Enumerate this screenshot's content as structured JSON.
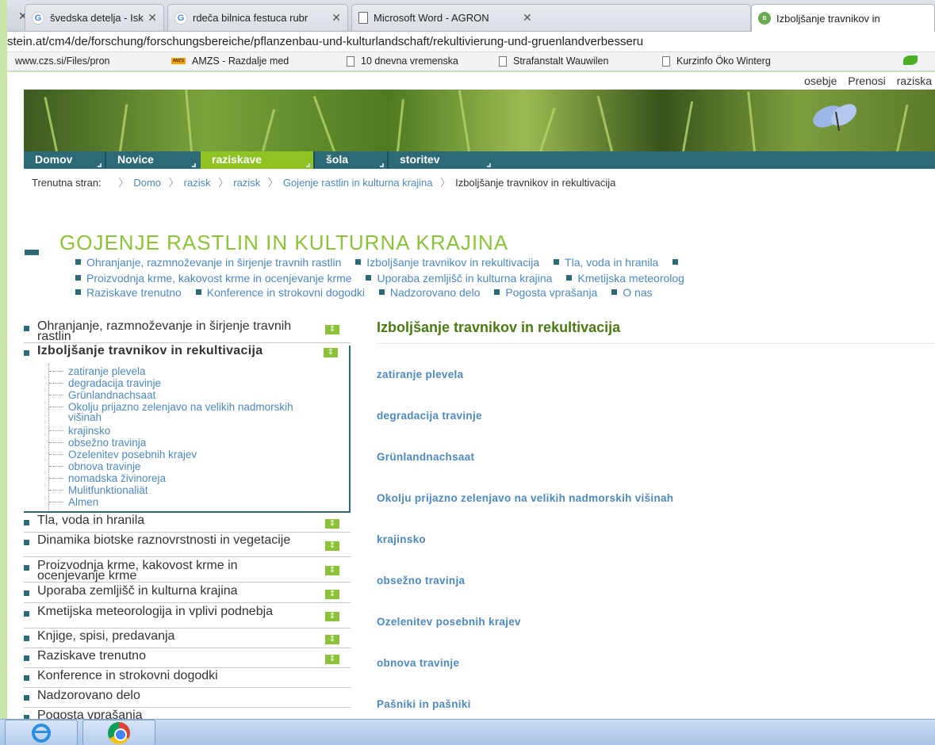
{
  "browser": {
    "tabs": [
      {
        "title": "švedska detelja - Iskanje",
        "icon": "google-icon",
        "active": false
      },
      {
        "title": "rdeča bilnica festuca rubr",
        "icon": "google-icon",
        "active": false
      },
      {
        "title": "Microsoft Word - AGRON",
        "icon": "document-icon",
        "active": false
      },
      {
        "title": "Izboljšanje travnikov in",
        "icon": "site-icon",
        "active": true
      }
    ],
    "url": "stein.at/cm4/de/forschung/forschungsbereiche/pflanzenbau-und-kulturlandschaft/rekultivierung-und-gruenlandverbesseru",
    "bookmarks": [
      {
        "label": "www.czs.si/Files/pron",
        "icon": "none"
      },
      {
        "label": "AMZS - Razdalje med",
        "icon": "amzs-icon"
      },
      {
        "label": "10 dnevna vremenska",
        "icon": "page-icon"
      },
      {
        "label": "Strafanstalt Wauwilen",
        "icon": "page-icon"
      },
      {
        "label": "Kurzinfo Öko Winterg",
        "icon": "page-icon"
      }
    ]
  },
  "site": {
    "topnav": [
      "osebje",
      "Prenosi",
      "raziska"
    ],
    "mainnav": [
      "Domov",
      "Novice",
      "raziskave",
      "šola",
      "storitev"
    ],
    "active_nav": "raziskave",
    "breadcrumb": {
      "prefix": "Trenutna stran:",
      "links": [
        "Domo",
        "razisk",
        "razisk",
        "Gojenje rastlin in kulturna krajina"
      ],
      "current": "Izboljšanje travnikov in rekultivacija"
    },
    "section_title": "GOJENJE RASTLIN IN KULTURNA KRAJINA",
    "sublinks": [
      [
        "Ohranjanje, razmnoževanje in širjenje travnih rastlin",
        "Izboljšanje travnikov in rekultivacija",
        "Tla, voda in hranila",
        ""
      ],
      [
        "Proizvodnja krme, kakovost krme in ocenjevanje krme",
        "Uporaba zemljišč in kulturna krajina",
        "Kmetijska meteorolog"
      ],
      [
        "Raziskave trenutno",
        "Konference in strokovni dogodki",
        "Nadzorovano delo",
        "Pogosta vprašanja",
        "O nas"
      ]
    ],
    "sidebar": [
      {
        "label": "Ohranjanje, razmnoževanje in širjenje travnih rastlin",
        "expandable": true
      },
      {
        "label": "Izboljšanje travnikov in rekultivacija",
        "expandable": true,
        "open": true
      },
      {
        "label": "Tla, voda in hranila",
        "expandable": true
      },
      {
        "label": "Dinamika biotske raznovrstnosti in vegetacije",
        "expandable": true
      },
      {
        "label": "Proizvodnja krme, kakovost krme in ocenjevanje krme",
        "expandable": true
      },
      {
        "label": "Uporaba zemljišč in kulturna krajina",
        "expandable": true
      },
      {
        "label": "Kmetijska meteorologija in vplivi podnebja",
        "expandable": true
      },
      {
        "label": "Knjige, spisi, predavanja",
        "expandable": true
      },
      {
        "label": "Raziskave trenutno",
        "expandable": true
      },
      {
        "label": "Konference in strokovni dogodki",
        "expandable": false
      },
      {
        "label": "Nadzorovano delo",
        "expandable": false
      },
      {
        "label": "Pogosta vprašanja",
        "expandable": false
      }
    ],
    "subtree": [
      "zatiranje plevela",
      "degradacija travinje",
      "Grünlandnachsaat",
      "Okolju prijazno zelenjavo na velikih nadmorskih višinah",
      "krajinsko",
      "obsežno travinja",
      "Ozelenitev posebnih krajev",
      "obnova travinje",
      "nomadska živinoreja",
      "Mulitfunktionaliät",
      "Almen"
    ],
    "content_title": "Izboljšanje travnikov in rekultivacija",
    "content_links": [
      "zatiranje plevela",
      "degradacija travinje",
      "Grünlandnachsaat",
      "Okolju prijazno zelenjavo na velikih nadmorskih višinah",
      "krajinsko",
      "obsežno travinja",
      "Ozelenitev posebnih krajev",
      "obnova travinje",
      "Pašniki in pašniki"
    ],
    "expand_symbol": "⇕",
    "colors": {
      "accent_green": "#8cc23a",
      "nav_teal": "#2d6a78",
      "link_blue": "#4d88bf"
    }
  },
  "taskbar": {
    "apps": [
      "internet-explorer-icon",
      "chrome-icon"
    ]
  }
}
